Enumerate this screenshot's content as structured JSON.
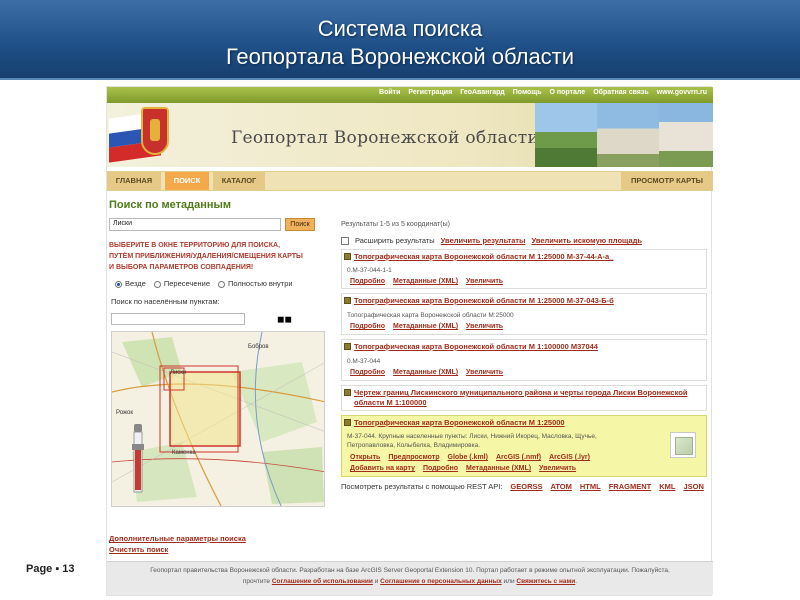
{
  "slide": {
    "title_line1": "Система поиска",
    "title_line2": "Геопортала Воронежской области",
    "page_label": "Page ▪ 13"
  },
  "portal": {
    "top_links": [
      "Войти",
      "Регистрация",
      "ГеоАвангард",
      "Помощь",
      "О портале",
      "Обратная связь",
      "www.govvrn.ru"
    ],
    "name": "Геопортал Воронежской области",
    "nav": {
      "home": "ГЛАВНАЯ",
      "search": "ПОИСК",
      "catalog": "КАТАЛОГ",
      "map_view": "ПРОСМОТР КАРТЫ"
    }
  },
  "search": {
    "section_title": "Поиск по метаданным",
    "query_value": "Лиски",
    "search_button": "Поиск",
    "instruction_l1": "ВЫБЕРИТЕ В ОКНЕ ТЕРРИТОРИЮ ДЛЯ ПОИСКА,",
    "instruction_l2": "ПУТЁМ ПРИБЛИЖЕНИЯ/УДАЛЕНИЯ/СМЕЩЕНИЯ КАРТЫ",
    "instruction_l3": "И ВЫБОРА ПАРАМЕТРОВ СОВПАДЕНИЯ!",
    "options": [
      "Везде",
      "Пересечение",
      "Полностью внутри"
    ],
    "selected_option": "Везде",
    "place_label": "Поиск по населённым пунктам:",
    "map_labels": {
      "bobrov": "Бобров",
      "liski": "Лиски",
      "rozhok": "Рожок",
      "kamenka": "Каменка"
    },
    "more_params": "Дополнительные параметры поиска",
    "clear": "Очистить поиск"
  },
  "results": {
    "count_text": "Результаты 1-5 из 5 координат(ы)",
    "expand_label": "Расширить результаты",
    "enlarge_results": "Увеличить результаты",
    "enlarge_area": "Увеличить искомую площадь",
    "items": [
      {
        "title": "Топографическая карта Воронежской области М 1:25000 М-37-44-А-а_",
        "desc": "0.М-37-044-1-1",
        "links": [
          "Подробно",
          "Метаданные (XML)",
          "Увеличить"
        ]
      },
      {
        "title": "Топографическая карта Воронежской области М 1:25000 М-37-043-Б-б",
        "desc": "Топографическая карта Воронежской области М:25000",
        "links": [
          "Подробно",
          "Метаданные (XML)",
          "Увеличить"
        ]
      },
      {
        "title": "Топографическая карта Воронежской области М 1:100000 M37044",
        "desc": "0.М-37-044",
        "links": [
          "Подробно",
          "Метаданные (XML)",
          "Увеличить"
        ]
      },
      {
        "title_l1": "Чертеж границ Лискинского муниципального района и черты города Лиски Воронежской",
        "title_l2": "области М 1:100000"
      },
      {
        "title": "Топографическая карта Воронежской области М 1:25000",
        "desc_l1": "М-37-044. Крупные населенные пункты: Лиски, Нижний Икорец, Масловка, Щучье,",
        "desc_l2": "Петропавловка, Колыбелка, Владимировка.",
        "links_row1": [
          "Открыть",
          "Предпросмотр",
          "Globe (.kml)",
          "ArcGIS (.nmf)",
          "ArcGIS (.lyr)"
        ],
        "links_row2": [
          "Добавить на карту",
          "Подробно",
          "Метаданные (XML)",
          "Увеличить"
        ]
      }
    ],
    "rest_label": "Посмотреть результаты с помощью REST API:",
    "rest_formats": [
      "GEORSS",
      "ATOM",
      "HTML",
      "FRAGMENT",
      "KML",
      "JSON"
    ]
  },
  "footer": {
    "line1": "Геопортал правительства Воронежской области. Разработан на базе ArcGIS Server Geoportal Extension 10. Портал работает в режиме опытной эксплуатации. Пожалуйста,",
    "line2_pre": "прочтите",
    "terms": "Соглашение об использовании",
    "and": "и",
    "privacy": "Соглашение о персональных данных",
    "or": "или",
    "contact": "Свяжитесь с нами",
    "dot": "."
  },
  "colors": {
    "header_blue": "#1e4f86",
    "link_red": "#a12c1c",
    "section_green": "#4e7a19",
    "highlight_yellow": "#f5f7a6",
    "active_tab": "#f5a94a"
  }
}
